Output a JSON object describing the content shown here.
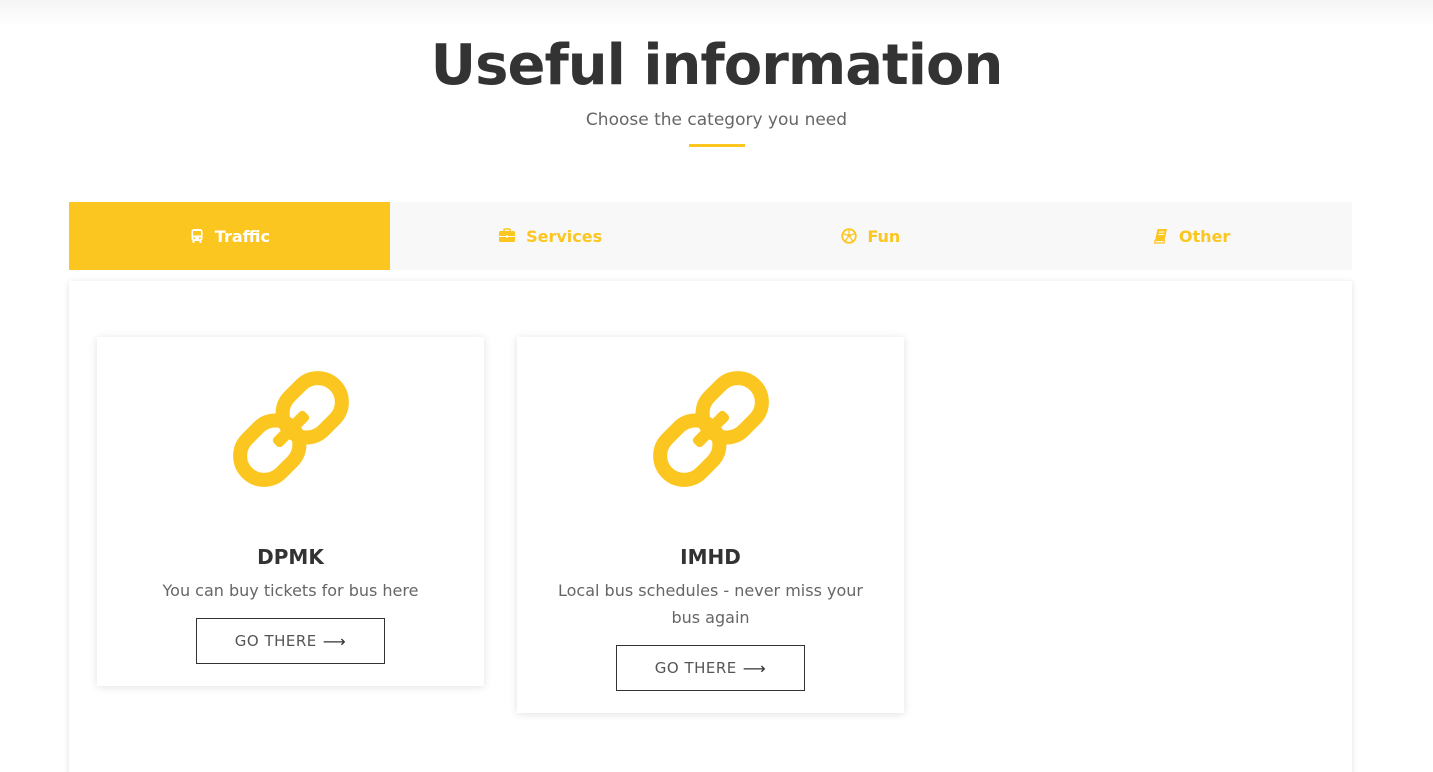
{
  "header": {
    "title": "Useful information",
    "subtitle": "Choose the category you need"
  },
  "tabs": [
    {
      "label": "Traffic",
      "icon": "bus-icon",
      "active": true
    },
    {
      "label": "Services",
      "icon": "briefcase-icon",
      "active": false
    },
    {
      "label": "Fun",
      "icon": "soccer-ball-icon",
      "active": false
    },
    {
      "label": "Other",
      "icon": "book-icon",
      "active": false
    }
  ],
  "cards": [
    {
      "icon": "link-icon",
      "title": "DPMK",
      "description": "You can buy tickets for bus here",
      "button": "GO THERE"
    },
    {
      "icon": "link-icon",
      "title": "IMHD",
      "description": "Local bus schedules - never miss your bus again",
      "button": "GO THERE"
    }
  ],
  "colors": {
    "accent": "#fcc621",
    "text": "#333333",
    "muted": "#666666",
    "tab_bg": "#f8f8f8"
  }
}
